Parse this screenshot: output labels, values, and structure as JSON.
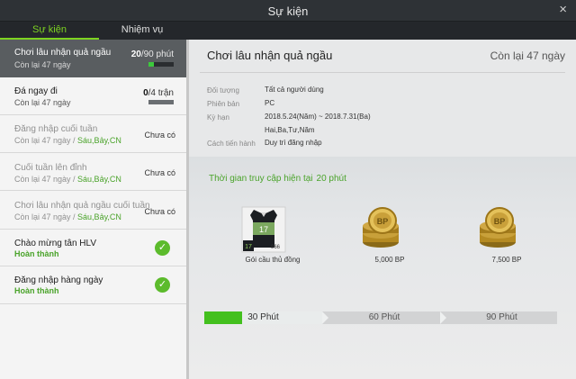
{
  "window": {
    "title": "Sự kiện",
    "close_glyph": "×"
  },
  "tabs": [
    {
      "label": "Sự kiện",
      "active": true
    },
    {
      "label": "Nhiệm vụ",
      "active": false
    }
  ],
  "sidebar": {
    "items": [
      {
        "name": "Chơi lâu nhận quả ngầu",
        "sub": "Còn lại 47 ngày",
        "count_current": "20",
        "count_total": "/90 phút",
        "progress_fraction": 0.22,
        "selected": true
      },
      {
        "name": "Đá ngay đi",
        "sub": "Còn lại 47 ngày",
        "count_current": "0",
        "count_total": "/4 trận",
        "progress_fraction": 0
      },
      {
        "name": "Đăng nhập cuối tuần",
        "sub_prefix": "Còn lại 47 ngày / ",
        "sub_days": "Sáu,Bảy,CN",
        "status": "Chưa có"
      },
      {
        "name": "Cuối tuần lên đỉnh",
        "sub_prefix": "Còn lại 47 ngày / ",
        "sub_days": "Sáu,Bảy,CN",
        "status": "Chưa có"
      },
      {
        "name": "Chơi lâu nhận quả ngầu cuối tuần",
        "sub_prefix": "Còn lại 47 ngày / ",
        "sub_days": "Sáu,Bảy,CN",
        "status": "Chưa có"
      },
      {
        "name": "Chào mừng tân HLV",
        "sub": "Hoàn thành",
        "check_icon": "check-icon"
      },
      {
        "name": "Đăng nhập hàng ngày",
        "sub": "Hoàn thành",
        "check_icon": "check-icon"
      }
    ]
  },
  "detail": {
    "title": "Chơi lâu nhận quả ngầu",
    "remaining": "Còn lại 47 ngày",
    "info": [
      {
        "label": "Đối tượng",
        "value": "Tất cả người dùng"
      },
      {
        "label": "Phiên bản",
        "value": "PC"
      },
      {
        "label": "Kỳ hạn",
        "value": "2018.5.24(Năm) ~ 2018.7.31(Ba)"
      },
      {
        "label": "",
        "value": "Hai,Ba,Tư,Năm"
      },
      {
        "label": "Cách tiến hành",
        "value": "Duy trì đăng nhập"
      }
    ],
    "access_time_label": "Thời gian truy cập hiện tại",
    "access_time_value": "20 phút",
    "rewards": [
      {
        "caption": "Gói cầu thủ đồng",
        "icon": "player-card-icon",
        "card_number": "17",
        "card_badge": "966"
      },
      {
        "caption": "5,000 BP",
        "icon": "coin-stack-icon",
        "coin_text": "BP"
      },
      {
        "caption": "7,500 BP",
        "icon": "coin-stack-icon",
        "coin_text": "BP"
      }
    ],
    "milestones": [
      {
        "label": "30 Phút"
      },
      {
        "label": "60 Phút"
      },
      {
        "label": "90 Phút"
      }
    ],
    "progress_fraction": 0.22,
    "colors": {
      "accent": "#7dd321",
      "progress_green": "#43c01e",
      "done_green": "#4aa32a"
    }
  }
}
